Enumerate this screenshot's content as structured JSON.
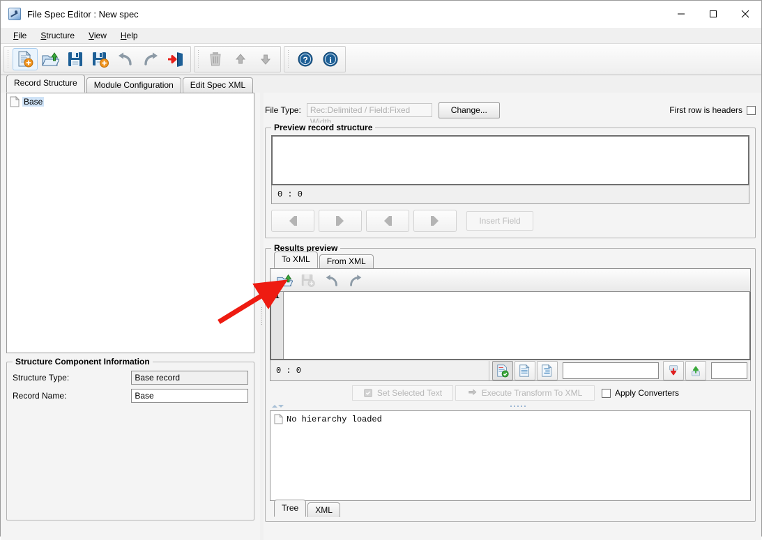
{
  "window": {
    "title": "File Spec Editor : New spec",
    "icon": "app-icon",
    "minimize": "minimize-icon",
    "maximize": "maximize-icon",
    "close": "close-icon"
  },
  "menubar": [
    {
      "label": "File",
      "mnemonic": "F"
    },
    {
      "label": "Structure",
      "mnemonic": "S"
    },
    {
      "label": "View",
      "mnemonic": "V"
    },
    {
      "label": "Help",
      "mnemonic": "H"
    }
  ],
  "toolbar": {
    "groups": [
      {
        "buttons": [
          {
            "name": "new-spec-icon",
            "selected": true
          },
          {
            "name": "open-spec-icon",
            "selected": false
          },
          {
            "name": "save-spec-icon",
            "selected": false
          },
          {
            "name": "save-as-spec-icon",
            "selected": false
          },
          {
            "name": "undo-icon",
            "selected": false
          },
          {
            "name": "redo-icon",
            "selected": false
          },
          {
            "name": "exit-icon",
            "selected": false
          }
        ]
      },
      {
        "buttons": [
          {
            "name": "delete-icon",
            "selected": false
          },
          {
            "name": "move-up-icon",
            "selected": false
          },
          {
            "name": "move-down-icon",
            "selected": false
          }
        ]
      },
      {
        "buttons": [
          {
            "name": "help-icon",
            "selected": false
          },
          {
            "name": "about-icon",
            "selected": false
          }
        ]
      }
    ]
  },
  "tabs": [
    {
      "label": "Record Structure",
      "active": true
    },
    {
      "label": "Module Configuration",
      "active": false
    },
    {
      "label": "Edit Spec XML",
      "active": false
    }
  ],
  "left": {
    "tree": {
      "nodes": [
        {
          "label": "Base",
          "selected": true,
          "icon": "document-icon"
        }
      ]
    },
    "component_info": {
      "title": "Structure Component Information",
      "fields": [
        {
          "label": "Structure Type:",
          "value": "Base record",
          "readonly": true
        },
        {
          "label": "Record Name:",
          "value": "Base",
          "readonly": false
        }
      ]
    }
  },
  "right": {
    "file_type": {
      "label": "File Type:",
      "value": "Rec:Delimited / Field:Fixed Width",
      "change_button": "Change...",
      "first_row_label": "First row is headers",
      "first_row_checked": false
    },
    "preview_record_structure": {
      "title": "Preview record structure",
      "content": "",
      "position": "0 : 0",
      "nav_buttons": [
        {
          "name": "first-field-button"
        },
        {
          "name": "prev-field-button"
        },
        {
          "name": "next-field-button"
        },
        {
          "name": "last-field-button"
        }
      ],
      "insert_field_button": "Insert Field"
    },
    "results_preview": {
      "title": "Results preview",
      "tabs": [
        {
          "label": "To XML",
          "active": true
        },
        {
          "label": "From XML",
          "active": false
        }
      ],
      "xml_toolbar": [
        {
          "name": "open-file-icon",
          "enabled": true
        },
        {
          "name": "save-file-icon",
          "enabled": false
        },
        {
          "name": "undo-icon",
          "enabled": true
        },
        {
          "name": "redo-icon",
          "enabled": true
        }
      ],
      "editor": {
        "line_number": "1",
        "content": "",
        "position": "0 : 0"
      },
      "status_buttons": [
        {
          "name": "validate-document-icon",
          "pressed": true
        },
        {
          "name": "plain-document-icon",
          "pressed": false
        },
        {
          "name": "structured-document-icon",
          "pressed": false
        }
      ],
      "search_field_value": "",
      "find-down": {
        "name": "find-down-icon"
      },
      "find-up": {
        "name": "find-up-icon"
      },
      "count_field_value": "",
      "set_selected_text_button": "Set Selected Text",
      "execute_transform_button": "Execute Transform To XML",
      "apply_converters_label": "Apply Converters",
      "apply_converters_checked": false,
      "hierarchy": {
        "message": "No hierarchy loaded",
        "icon": "document-icon"
      },
      "bottom_tabs": [
        {
          "label": "Tree",
          "active": true
        },
        {
          "label": "XML",
          "active": false
        }
      ]
    }
  },
  "annotation": {
    "arrow_color": "#ee1b11",
    "points_to": "open-file-icon"
  }
}
